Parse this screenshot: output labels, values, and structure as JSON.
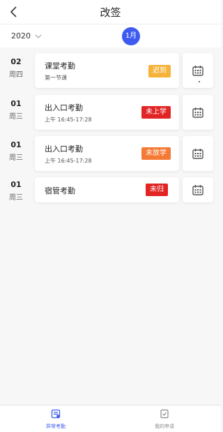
{
  "header": {
    "title": "改签",
    "back_icon": "chevron-left-icon"
  },
  "filter": {
    "year": "2020",
    "month": "1月"
  },
  "records": [
    {
      "day": "02",
      "weekday": "周四",
      "title": "课堂考勤",
      "subtitle": "第一节课",
      "status": "迟到",
      "status_color": "#f5b33a"
    },
    {
      "day": "01",
      "weekday": "周三",
      "title": "出入口考勤",
      "subtitle": "上午 16:45-17:28",
      "status": "未上学",
      "status_color": "#e12424"
    },
    {
      "day": "01",
      "weekday": "周三",
      "title": "出入口考勤",
      "subtitle": "上午 16:45-17:28",
      "status": "未放学",
      "status_color": "#f47a35"
    },
    {
      "day": "01",
      "weekday": "周三",
      "title": "宿管考勤",
      "subtitle": "",
      "status": "未归",
      "status_color": "#e12424"
    }
  ],
  "tabbar": {
    "tabs": [
      {
        "label": "异常考勤",
        "icon": "attendance-icon",
        "active": true
      },
      {
        "label": "我的申请",
        "icon": "application-icon",
        "active": false
      }
    ]
  },
  "colors": {
    "accent": "#3d5af1",
    "inactive": "#8a8a8a"
  }
}
